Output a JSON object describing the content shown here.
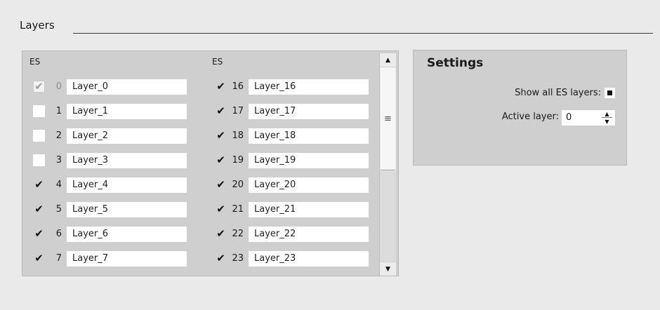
{
  "section": {
    "title": "Layers"
  },
  "layers": {
    "left_header": "ES",
    "right_header": "ES",
    "left_rows": [
      {
        "num": "0",
        "name": "Layer_0",
        "state": "disabled-checked"
      },
      {
        "num": "1",
        "name": "Layer_1",
        "state": "unchecked"
      },
      {
        "num": "2",
        "name": "Layer_2",
        "state": "unchecked"
      },
      {
        "num": "3",
        "name": "Layer_3",
        "state": "unchecked"
      },
      {
        "num": "4",
        "name": "Layer_4",
        "state": "checked"
      },
      {
        "num": "5",
        "name": "Layer_5",
        "state": "checked"
      },
      {
        "num": "6",
        "name": "Layer_6",
        "state": "checked"
      },
      {
        "num": "7",
        "name": "Layer_7",
        "state": "checked"
      }
    ],
    "right_rows": [
      {
        "num": "16",
        "name": "Layer_16",
        "state": "checked"
      },
      {
        "num": "17",
        "name": "Layer_17",
        "state": "checked"
      },
      {
        "num": "18",
        "name": "Layer_18",
        "state": "checked"
      },
      {
        "num": "19",
        "name": "Layer_19",
        "state": "checked"
      },
      {
        "num": "20",
        "name": "Layer_20",
        "state": "checked"
      },
      {
        "num": "21",
        "name": "Layer_21",
        "state": "checked"
      },
      {
        "num": "22",
        "name": "Layer_22",
        "state": "checked"
      },
      {
        "num": "23",
        "name": "Layer_23",
        "state": "checked"
      }
    ],
    "scrollbar": {
      "up_icon": "triangle-up-icon",
      "down_icon": "triangle-down-icon",
      "grip_icon": "scroll-grip-icon"
    }
  },
  "settings": {
    "title": "Settings",
    "show_all_label": "Show all ES layers:",
    "show_all_state": "indeterminate",
    "active_layer_label": "Active layer:",
    "active_layer_value": "0"
  },
  "colors": {
    "background": "#eaeaea",
    "panel": "#cfcfcf",
    "field": "#ffffff",
    "text": "#1a1a1a",
    "disabled_text": "#8c8c8c"
  }
}
